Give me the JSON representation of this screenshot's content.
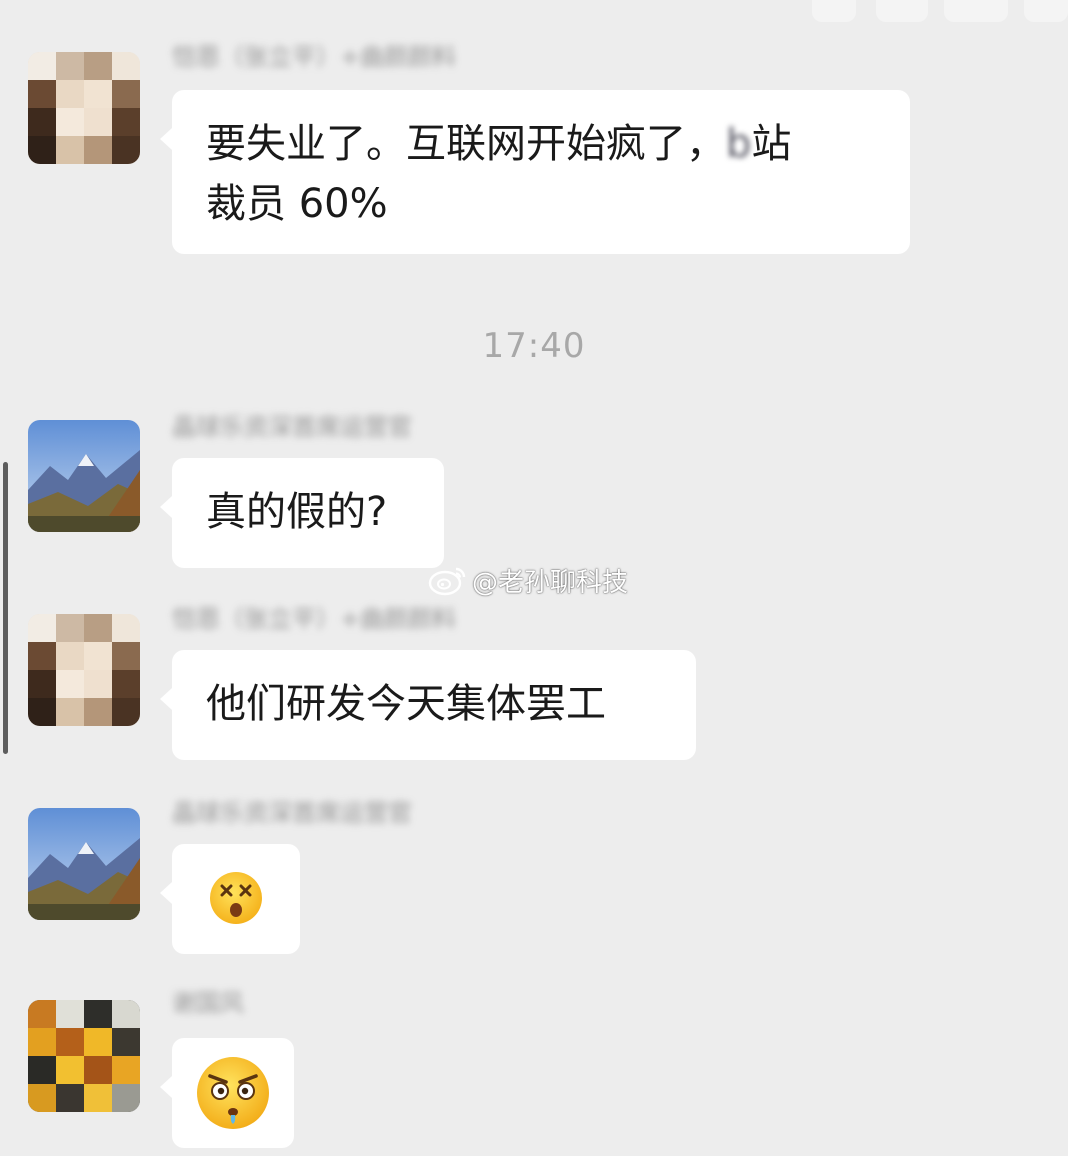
{
  "messages": [
    {
      "sender": "redacted-name-1",
      "nickname": "恺恩（张立平）+曲颜颜料",
      "text_main": "要失业了。互联网开始疯了，",
      "text_blurred": "b",
      "text_tail": "站",
      "text_line2": "裁员 60%"
    },
    {
      "sender": "redacted-name-2",
      "nickname": "晶球乐资深首席运营官",
      "text": "真的假的?"
    },
    {
      "sender": "redacted-name-1",
      "nickname": "恺恩（张立平）+曲颜颜料",
      "text": "他们研发今天集体罢工"
    },
    {
      "sender": "redacted-name-2",
      "nickname": "晶球乐资深首席运营官",
      "emoji": "dizzy-face-emoji"
    },
    {
      "sender": "redacted-name-3",
      "nickname": "谢国风",
      "emoji": "angry-face-emoji"
    }
  ],
  "timestamp": "17:40",
  "watermark": {
    "text": "@老孙聊科技",
    "icon": "weibo-icon"
  },
  "colors": {
    "background": "#ededed",
    "bubble": "#ffffff",
    "text": "#1a1a1a",
    "timestamp": "#a8a8a8"
  }
}
